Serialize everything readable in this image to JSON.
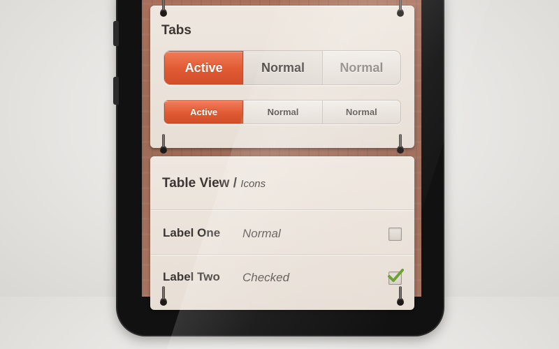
{
  "tabs_section": {
    "title": "Tabs",
    "large_tabs": [
      {
        "label": "Active",
        "state": "active"
      },
      {
        "label": "Normal",
        "state": "normal"
      },
      {
        "label": "Normal",
        "state": "faded"
      }
    ],
    "small_tabs": [
      {
        "label": "Active",
        "state": "active"
      },
      {
        "label": "Normal",
        "state": "normal"
      },
      {
        "label": "Normal",
        "state": "normal"
      }
    ]
  },
  "table_view": {
    "title": "Table View",
    "separator": "/",
    "subtitle": "Icons",
    "rows": [
      {
        "label": "Label One",
        "value": "Normal",
        "checked": false
      },
      {
        "label": "Label Two",
        "value": "Checked",
        "checked": true
      }
    ]
  },
  "colors": {
    "accent": "#e05a33",
    "check": "#6aa22e",
    "wood": "#a8705a",
    "card": "#eee7df"
  }
}
